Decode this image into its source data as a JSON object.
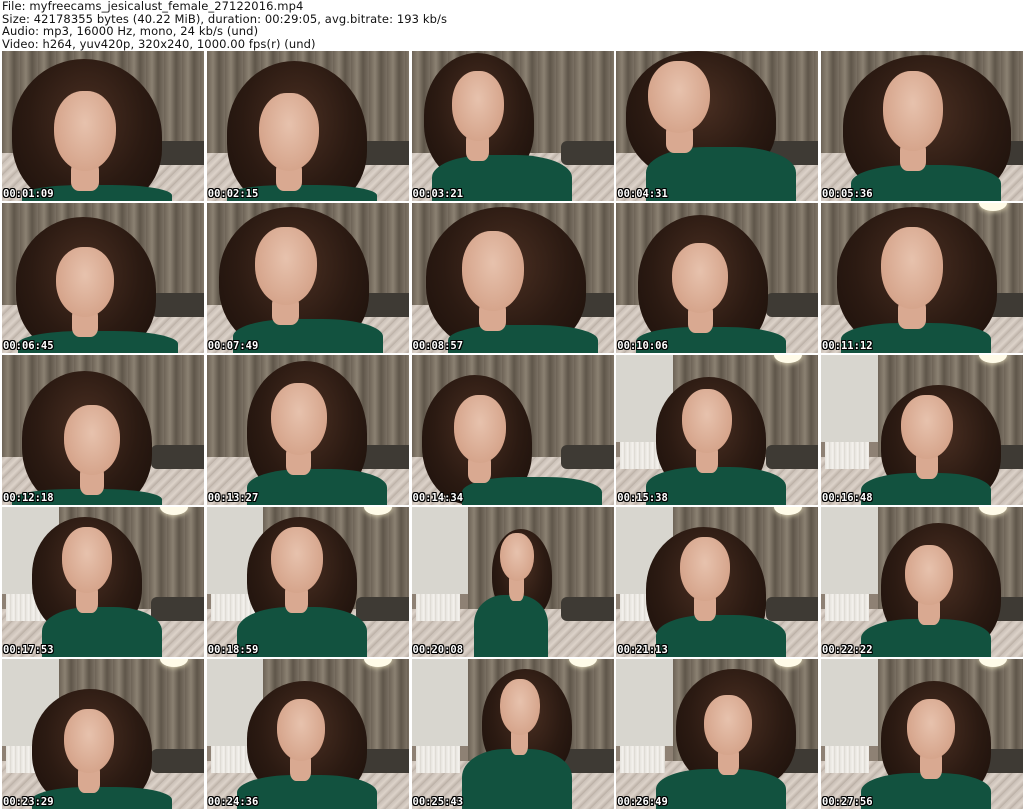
{
  "header": {
    "file": "File: myfreecams_jesicalust_female_27122016.mp4",
    "size": "Size: 42178355 bytes (40.22 MiB), duration: 00:29:05, avg.bitrate: 193 kb/s",
    "audio": "Audio: mp3, 16000 Hz, mono, 24 kb/s (und)",
    "video": "Video: h264, yuv420p, 320x240, 1000.00 fps(r) (und)"
  },
  "thumbnails": [
    {
      "time": "00:01:09"
    },
    {
      "time": "00:02:15"
    },
    {
      "time": "00:03:21"
    },
    {
      "time": "00:04:31"
    },
    {
      "time": "00:05:36"
    },
    {
      "time": "00:06:45"
    },
    {
      "time": "00:07:49"
    },
    {
      "time": "00:08:57"
    },
    {
      "time": "00:10:06"
    },
    {
      "time": "00:11:12"
    },
    {
      "time": "00:12:18"
    },
    {
      "time": "00:13:27"
    },
    {
      "time": "00:14:34"
    },
    {
      "time": "00:15:38"
    },
    {
      "time": "00:16:48"
    },
    {
      "time": "00:17:53"
    },
    {
      "time": "00:18:59"
    },
    {
      "time": "00:20:08"
    },
    {
      "time": "00:21:13"
    },
    {
      "time": "00:22:22"
    },
    {
      "time": "00:23:29"
    },
    {
      "time": "00:24:36"
    },
    {
      "time": "00:25:43"
    },
    {
      "time": "00:26:49"
    },
    {
      "time": "00:27:56"
    }
  ],
  "colors": {
    "shirt": "#12523f",
    "hair": "#2b1a12",
    "curtain": "#6e6457",
    "timestamp_text": "#ffffff",
    "timestamp_outline": "#000000"
  }
}
